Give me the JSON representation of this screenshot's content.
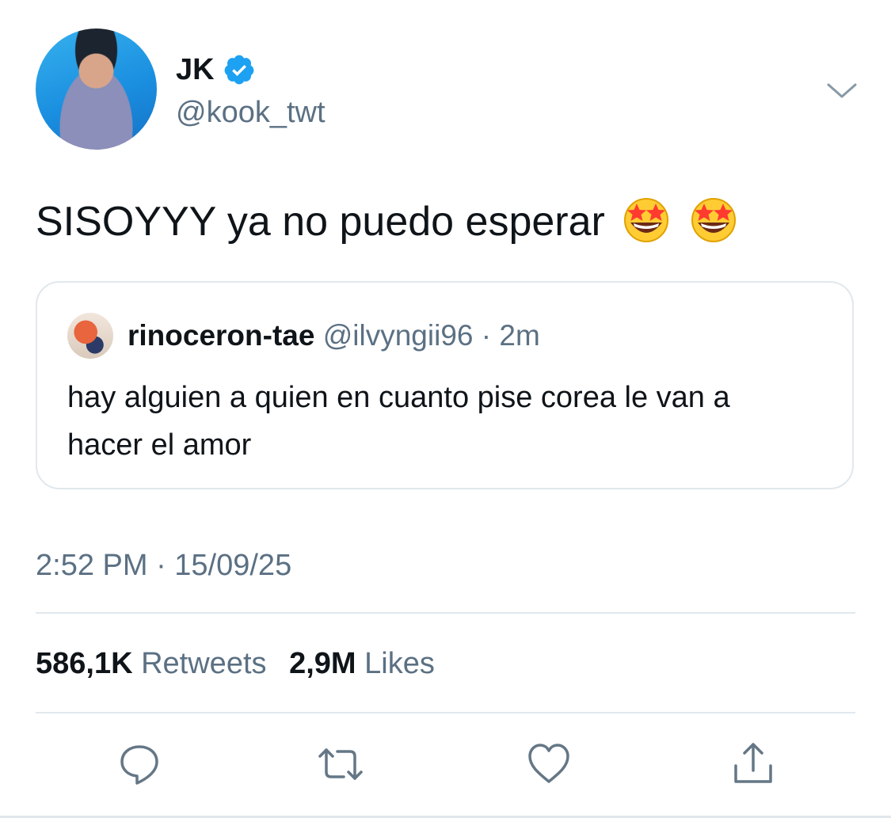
{
  "author": {
    "name": "JK",
    "handle": "@kook_twt",
    "verified": true
  },
  "menu": {
    "icon": "chevron-down-icon"
  },
  "tweet": {
    "text": "SISOYYY ya no puedo esperar",
    "emojis": [
      "star-struck-emoji",
      "star-struck-emoji"
    ]
  },
  "quote": {
    "name": "rinoceron-tae",
    "handle": "@ilvyngii96",
    "separator": "·",
    "time": "2m",
    "text": "hay alguien a quien en cuanto pise corea le van a hacer el amor"
  },
  "timestamp": "2:52 PM · 15/09/25",
  "stats": {
    "retweets_count": "586,1K",
    "retweets_label": "Retweets",
    "likes_count": "2,9M",
    "likes_label": "Likes"
  },
  "actions": [
    "reply-icon",
    "retweet-icon",
    "like-icon",
    "share-icon"
  ],
  "colors": {
    "text": "#0f1419",
    "secondary": "#5b7083",
    "verified": "#1da1f2",
    "border": "#e1e8ed"
  }
}
